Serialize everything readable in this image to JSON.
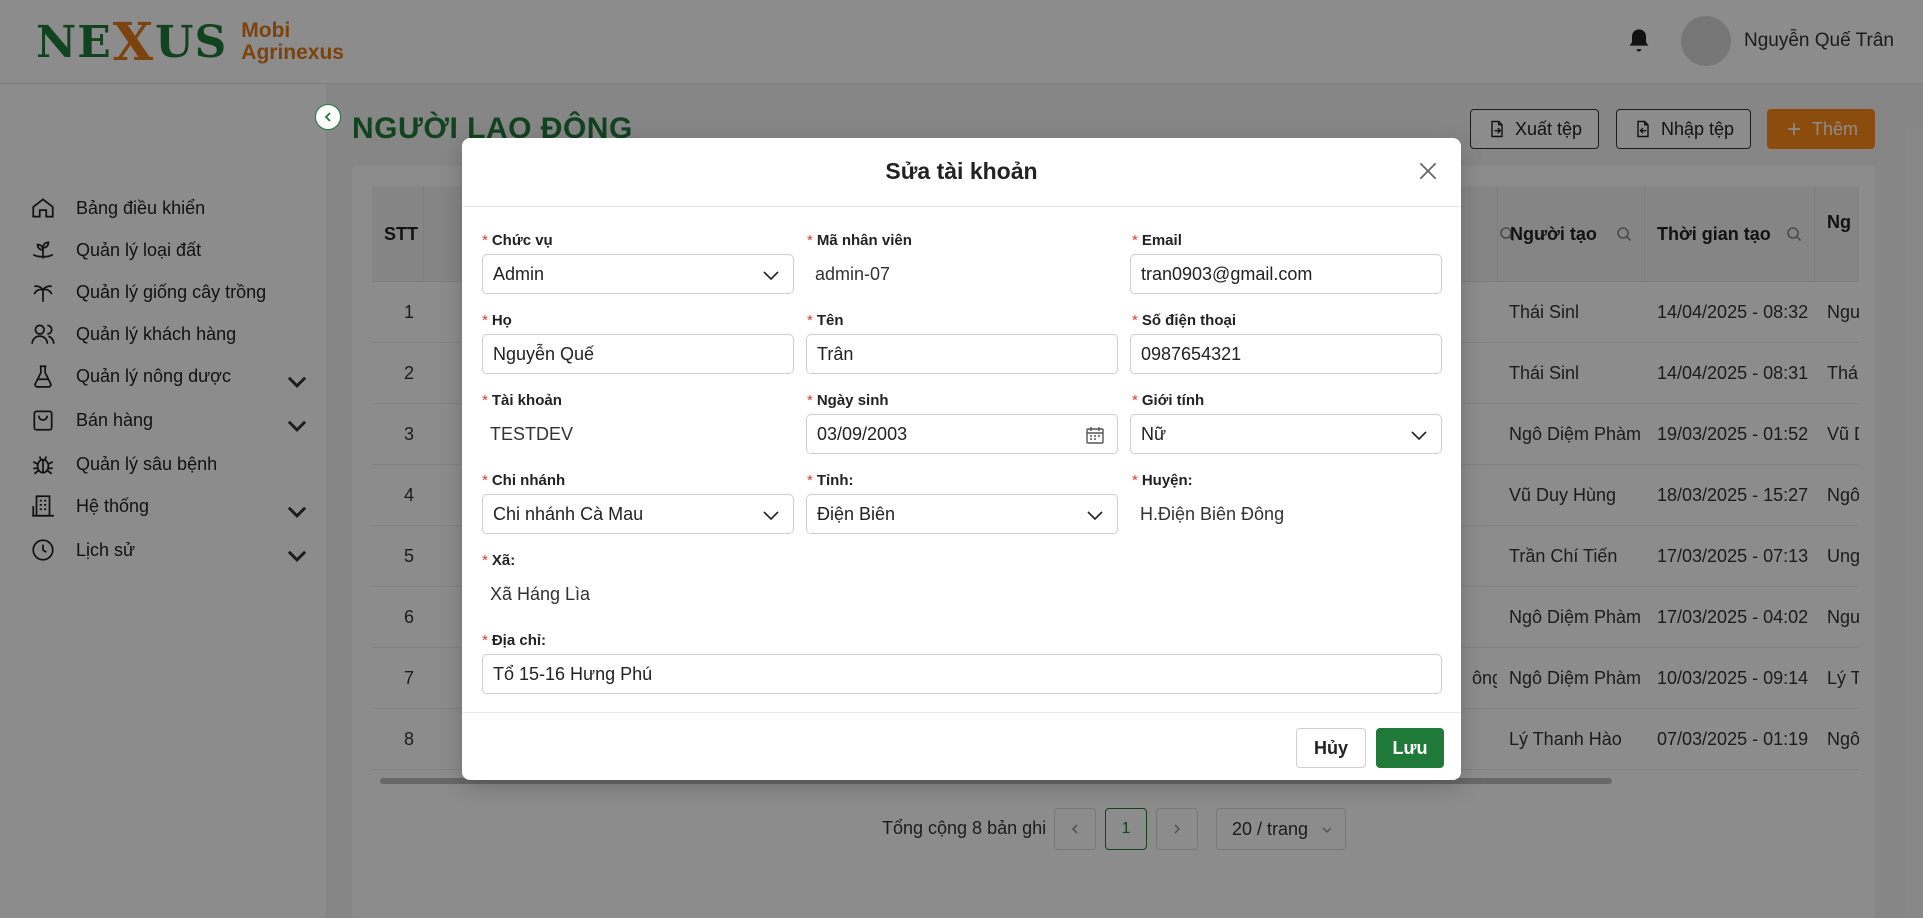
{
  "brand": {
    "mark_left": "NE",
    "mark_x": "X",
    "mark_right": "US",
    "line1": "Mobi",
    "line2": "Agrinexus",
    "primary_color": "#1f7a3a",
    "accent_color": "#e07a1a"
  },
  "header": {
    "user_name": "Nguyễn Quế Trân"
  },
  "sidebar": {
    "items": [
      {
        "label": "Bảng điều khiển",
        "icon": "home-icon"
      },
      {
        "label": "Quản lý loại đất",
        "icon": "soil-plant-icon"
      },
      {
        "label": "Quản lý giống cây trồng",
        "icon": "tree-icon"
      },
      {
        "label": "Quản lý khách hàng",
        "icon": "users-icon"
      },
      {
        "label": "Quản lý nông dược",
        "icon": "flask-icon",
        "has_children": true
      },
      {
        "label": "Bán hàng",
        "icon": "shopping-bag-icon",
        "has_children": true
      },
      {
        "label": "Quản lý sâu bệnh",
        "icon": "bug-icon"
      },
      {
        "label": "Hệ thống",
        "icon": "building-icon",
        "has_children": true
      },
      {
        "label": "Lịch sử",
        "icon": "clock-icon",
        "has_children": true
      }
    ]
  },
  "page": {
    "title": "NGƯỜI LAO ĐỘNG",
    "export_label": "Xuất tệp",
    "import_label": "Nhập tệp",
    "add_label": "Thêm"
  },
  "table": {
    "headers": {
      "stt": "STT",
      "creator": "Người tạo",
      "created_at": "Thời gian tạo",
      "next": "Ng"
    },
    "rows": [
      {
        "stt": "1",
        "partial": "",
        "creator": "Thái Sinl",
        "created_at": "14/04/2025 - 08:32",
        "next": "Ngu"
      },
      {
        "stt": "2",
        "partial": "",
        "creator": "Thái Sinl",
        "created_at": "14/04/2025 - 08:31",
        "next": "Thái"
      },
      {
        "stt": "3",
        "partial": "",
        "creator": "Ngô Diệm Phàm",
        "created_at": "19/03/2025 - 01:52",
        "next": "Vũ D"
      },
      {
        "stt": "4",
        "partial": "",
        "creator": "Vũ Duy Hùng",
        "created_at": "18/03/2025 - 15:27",
        "next": "Ngô"
      },
      {
        "stt": "5",
        "partial": "",
        "creator": "Trần Chí Tiến",
        "created_at": "17/03/2025 - 07:13",
        "next": "Ung"
      },
      {
        "stt": "6",
        "partial": "",
        "creator": "Ngô Diệm Phàm",
        "created_at": "17/03/2025 - 04:02",
        "next": "Ngu"
      },
      {
        "stt": "7",
        "partial": "ông",
        "creator": "Ngô Diệm Phàm",
        "created_at": "10/03/2025 - 09:14",
        "next": "Lý T"
      },
      {
        "stt": "8",
        "partial": "",
        "creator": "Lý Thanh Hào",
        "created_at": "07/03/2025 - 01:19",
        "next": "Ngô"
      }
    ]
  },
  "pagination": {
    "total_text": "Tổng cộng 8 bản ghi",
    "current_page": "1",
    "page_size": "20 / trang"
  },
  "modal": {
    "title": "Sửa tài khoản",
    "fields": {
      "position": {
        "label": "Chức vụ",
        "value": "Admin"
      },
      "employee_code": {
        "label": "Mã nhân viên",
        "value": "admin-07"
      },
      "email": {
        "label": "Email",
        "value": "tran0903@gmail.com"
      },
      "last_name": {
        "label": "Họ",
        "value": "Nguyễn Quế"
      },
      "first_name": {
        "label": "Tên",
        "value": "Trân"
      },
      "phone": {
        "label": "Số điện thoại",
        "value": "0987654321"
      },
      "account": {
        "label": "Tài khoản",
        "value": "TESTDEV"
      },
      "birth_date": {
        "label": "Ngày sinh",
        "value": "03/09/2003"
      },
      "gender": {
        "label": "Giới tính",
        "value": "Nữ"
      },
      "branch": {
        "label": "Chi nhánh",
        "value": "Chi nhánh Cà Mau"
      },
      "province": {
        "label": "Tỉnh:",
        "value": "Điện Biên"
      },
      "district": {
        "label": "Huyện:",
        "value": "H.Điện Biên Đông"
      },
      "ward": {
        "label": "Xã:",
        "value": "Xã Háng Lìa"
      },
      "address": {
        "label": "Địa chỉ:",
        "value": "Tổ 15-16 Hưng Phú"
      }
    },
    "required_mark": "*",
    "cancel_label": "Hủy",
    "save_label": "Lưu"
  }
}
